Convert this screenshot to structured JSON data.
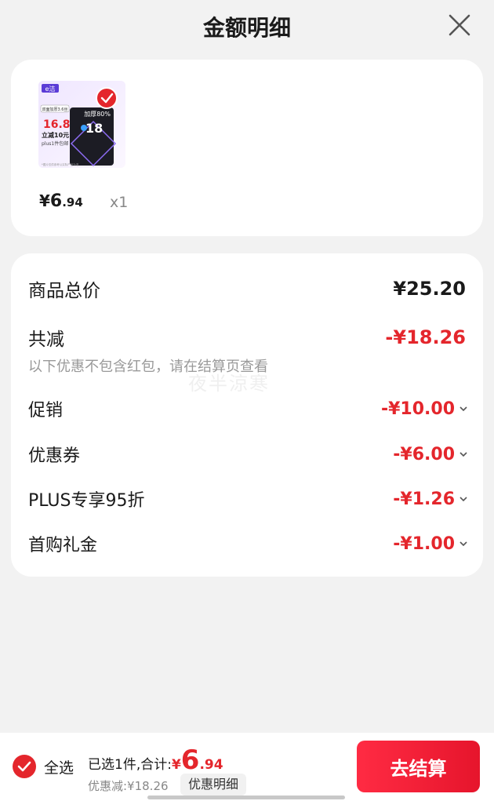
{
  "header": {
    "title": "金额明细"
  },
  "product": {
    "thumbnail": {
      "brand_mark": "e洁",
      "badge": "双面加厚3.6丝",
      "promo_price": "16.8",
      "promo_line1": "立减10元",
      "promo_line2": "plus1件包邮",
      "capacity": "加厚80%",
      "count": "18",
      "footnote": "*图片仅供参考以实际产品为准"
    },
    "price_yen": "¥",
    "price_int": "6",
    "price_dec": ".94",
    "quantity": "x1"
  },
  "detail": {
    "total_label": "商品总价",
    "total_value": "¥25.20",
    "reduce_label": "共减",
    "reduce_value": "-¥18.26",
    "note": "以下优惠不包含红包，请在结算页查看",
    "watermark": "夜半涼寒",
    "items": [
      {
        "label": "促销",
        "value": "-¥10.00"
      },
      {
        "label": "优惠券",
        "value": "-¥6.00"
      },
      {
        "label": "PLUS专享95折",
        "value": "-¥1.26"
      },
      {
        "label": "首购礼金",
        "value": "-¥1.00"
      }
    ]
  },
  "bottom": {
    "select_all": "全选",
    "selected_prefix": "已选1件,合计:",
    "total_yen": "¥",
    "total_int": "6",
    "total_dec": ".94",
    "discount": "优惠减:¥18.26",
    "detail_button": "优惠明细",
    "checkout": "去结算"
  },
  "colors": {
    "accent": "#e4262c",
    "background": "#f2f2f2",
    "card": "#ffffff"
  }
}
